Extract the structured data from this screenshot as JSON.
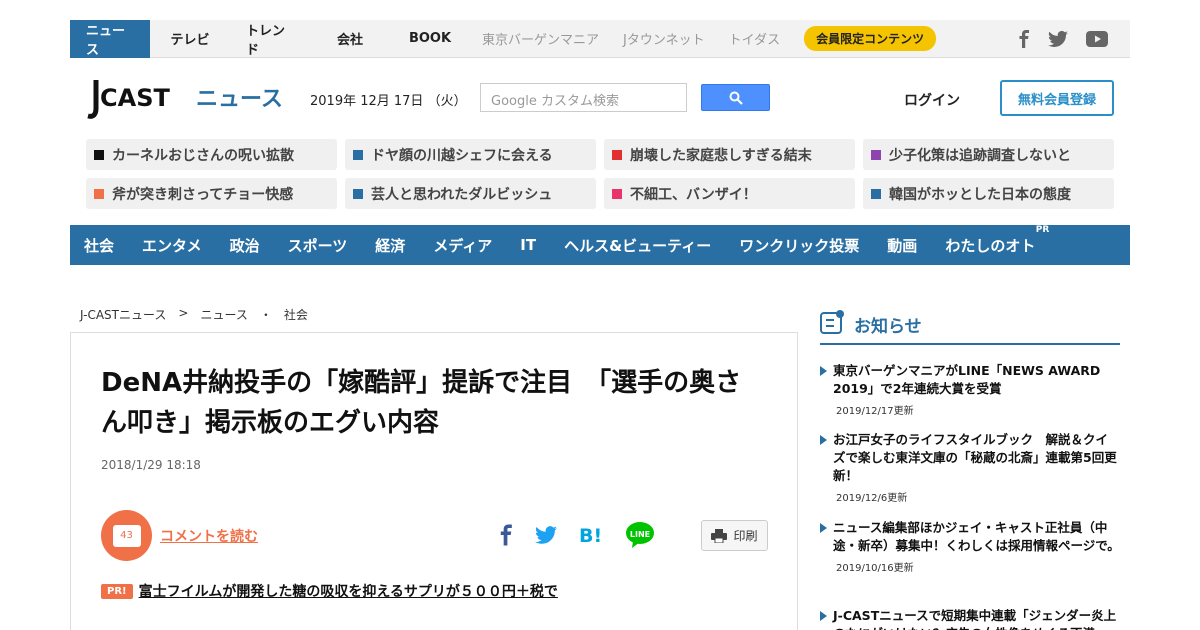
{
  "topnav": {
    "items": [
      "ニュース",
      "テレビ",
      "トレンド",
      "会社",
      "BOOK"
    ],
    "partners": [
      "東京バーゲンマニア",
      "Jタウンネット",
      "トイダス"
    ],
    "member_pill": "会員限定コンテンツ"
  },
  "header": {
    "logo_text": "J-CAST ニュース",
    "date": "2019年 12月 17日 （火）",
    "search_placeholder": "Google カスタム検索",
    "login": "ログイン",
    "register": "無料会員登録"
  },
  "tags": [
    {
      "label": "カーネルおじさんの呪い拡散",
      "color": "#111111"
    },
    {
      "label": "ドヤ顔の川越シェフに会える",
      "color": "#2a6fa3"
    },
    {
      "label": "崩壊した家庭悲しすぎる結末",
      "color": "#e03030"
    },
    {
      "label": "少子化策は追跡調査しないと",
      "color": "#8e44ad"
    },
    {
      "label": "斧が突き刺さってチョー快感",
      "color": "#f07048"
    },
    {
      "label": "芸人と思われたダルビッシュ",
      "color": "#2a6fa3"
    },
    {
      "label": "不細工、バンザイ！",
      "color": "#e8336b"
    },
    {
      "label": "韓国がホッとした日本の態度",
      "color": "#2a6fa3"
    }
  ],
  "categories": [
    "社会",
    "エンタメ",
    "政治",
    "スポーツ",
    "経済",
    "メディア",
    "IT",
    "ヘルス&ビューティー",
    "ワンクリック投票",
    "動画",
    "わたしのオト"
  ],
  "pr_mark": "PR",
  "breadcrumb": [
    "J-CASTニュース",
    ">",
    "ニュース",
    "・",
    "社会"
  ],
  "article": {
    "headline": "DeNA井納投手の「嫁酷評」提訴で注目　「選手の奥さん叩き」掲示板のエグい内容",
    "date": "2018/1/29 18:18",
    "comment_count": "43",
    "comment_link": "コメントを読む",
    "print": "印刷",
    "pr_badge": "PR!",
    "pr_text": "富士フイルムが開発した糖の吸収を抑えるサプリが５００円＋税で"
  },
  "sidebar": {
    "title": "お知らせ",
    "news": [
      {
        "title": "東京バーゲンマニアがLINE「NEWS AWARD 2019」で2年連続大賞を受賞",
        "date": "2019/12/17更新"
      },
      {
        "title": "お江戸女子のライフスタイルブック　解説＆クイズで楽しむ東洋文庫の「秘蔵の北斎」連載第5回更新！",
        "date": "2019/12/6更新"
      },
      {
        "title": "ニュース編集部ほかジェイ・キャスト正社員（中途・新卒）募集中！くわしくは採用情報ページで。",
        "date": "2019/10/16更新"
      },
      {
        "title": "J-CASTニュースで短期集中連載「ジェンダー炎上のなにがいけない？広告の女性像をめぐる不満",
        "date": ""
      }
    ]
  },
  "colors": {
    "brand_blue": "#2a6fa3",
    "accent_orange": "#f07048",
    "pill_yellow": "#f5c400"
  }
}
